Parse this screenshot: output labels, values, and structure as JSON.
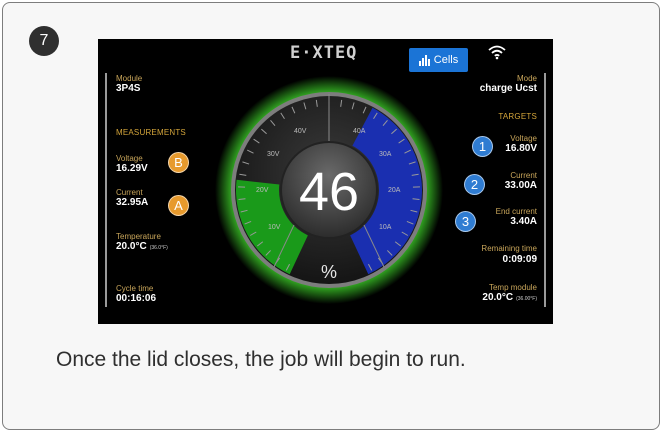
{
  "step": {
    "number": "7"
  },
  "caption": {
    "text": "Once the lid closes, the job will begin to run."
  },
  "device": {
    "logo": "E·XTEQ",
    "cells_button": "Cells",
    "left": {
      "module_label": "Module",
      "module_value": "3P4S",
      "measurements_heading": "MEASUREMENTS",
      "voltage_label": "Voltage",
      "voltage_value": "16.29V",
      "current_label": "Current",
      "current_value": "32.95A",
      "temperature_label": "Temperature",
      "temperature_value": "20.0°C",
      "temperature_f": "(36.0°F)",
      "cycle_label": "Cycle time",
      "cycle_value": "00:16:06"
    },
    "right": {
      "mode_label": "Mode",
      "mode_value": "charge Ucst",
      "targets_heading": "TARGETS",
      "voltage_label": "Voltage",
      "voltage_value": "16.80V",
      "current_label": "Current",
      "current_value": "33.00A",
      "end_current_label": "End current",
      "end_current_value": "3.40A",
      "remaining_label": "Remaining time",
      "remaining_value": "0:09:09",
      "temp_module_label": "Temp module",
      "temp_module_value": "20.0°C",
      "temp_module_f": "(36.00°F)"
    },
    "gauge": {
      "value": "46",
      "unit": "%",
      "left_ticks": [
        "40V",
        "30V",
        "20V",
        "10V"
      ],
      "right_ticks": [
        "40A",
        "30A",
        "20A",
        "10A"
      ],
      "green_level": 0.46,
      "blue_level": 0.82
    },
    "markers": {
      "a": "A",
      "b": "B",
      "one": "1",
      "two": "2",
      "three": "3"
    },
    "colors": {
      "accent_blue": "#1b74d6",
      "glow_green": "#3fd42a",
      "arc_blue": "#1a2fb0",
      "arc_green": "#1a9a1a",
      "section_gold": "#d4a53a",
      "marker_orange": "#e79a2d",
      "marker_blue": "#2f7cd2"
    }
  }
}
